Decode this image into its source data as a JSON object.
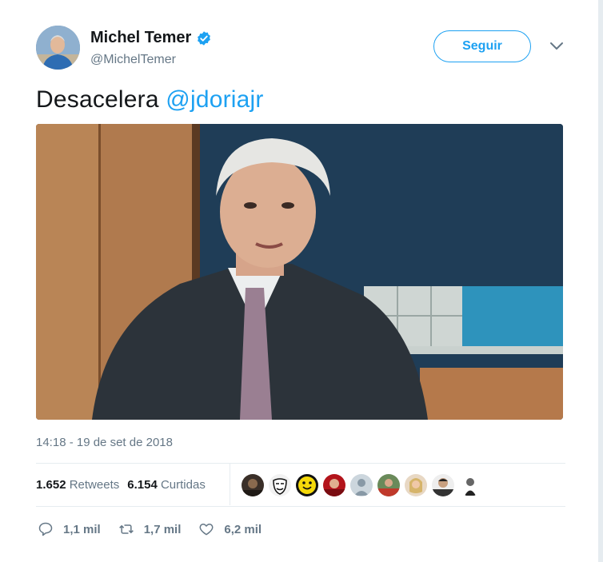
{
  "author": {
    "name": "Michel Temer",
    "handle": "@MichelTemer",
    "verified": true
  },
  "follow_label": "Seguir",
  "tweet": {
    "text": "Desacelera",
    "mention": "@jdoriajr"
  },
  "timestamp": "14:18 - 19 de set de 2018",
  "stats": {
    "retweets_count": "1.652",
    "retweets_label": "Retweets",
    "likes_count": "6.154",
    "likes_label": "Curtidas"
  },
  "actions": {
    "replies": "1,1 mil",
    "retweets": "1,7 mil",
    "likes": "6,2 mil"
  },
  "colors": {
    "accent": "#1da1f2",
    "text": "#14171a",
    "muted": "#657786"
  },
  "icons": [
    "verified-badge-icon",
    "chevron-down-icon",
    "reply-icon",
    "retweet-icon",
    "like-icon"
  ]
}
